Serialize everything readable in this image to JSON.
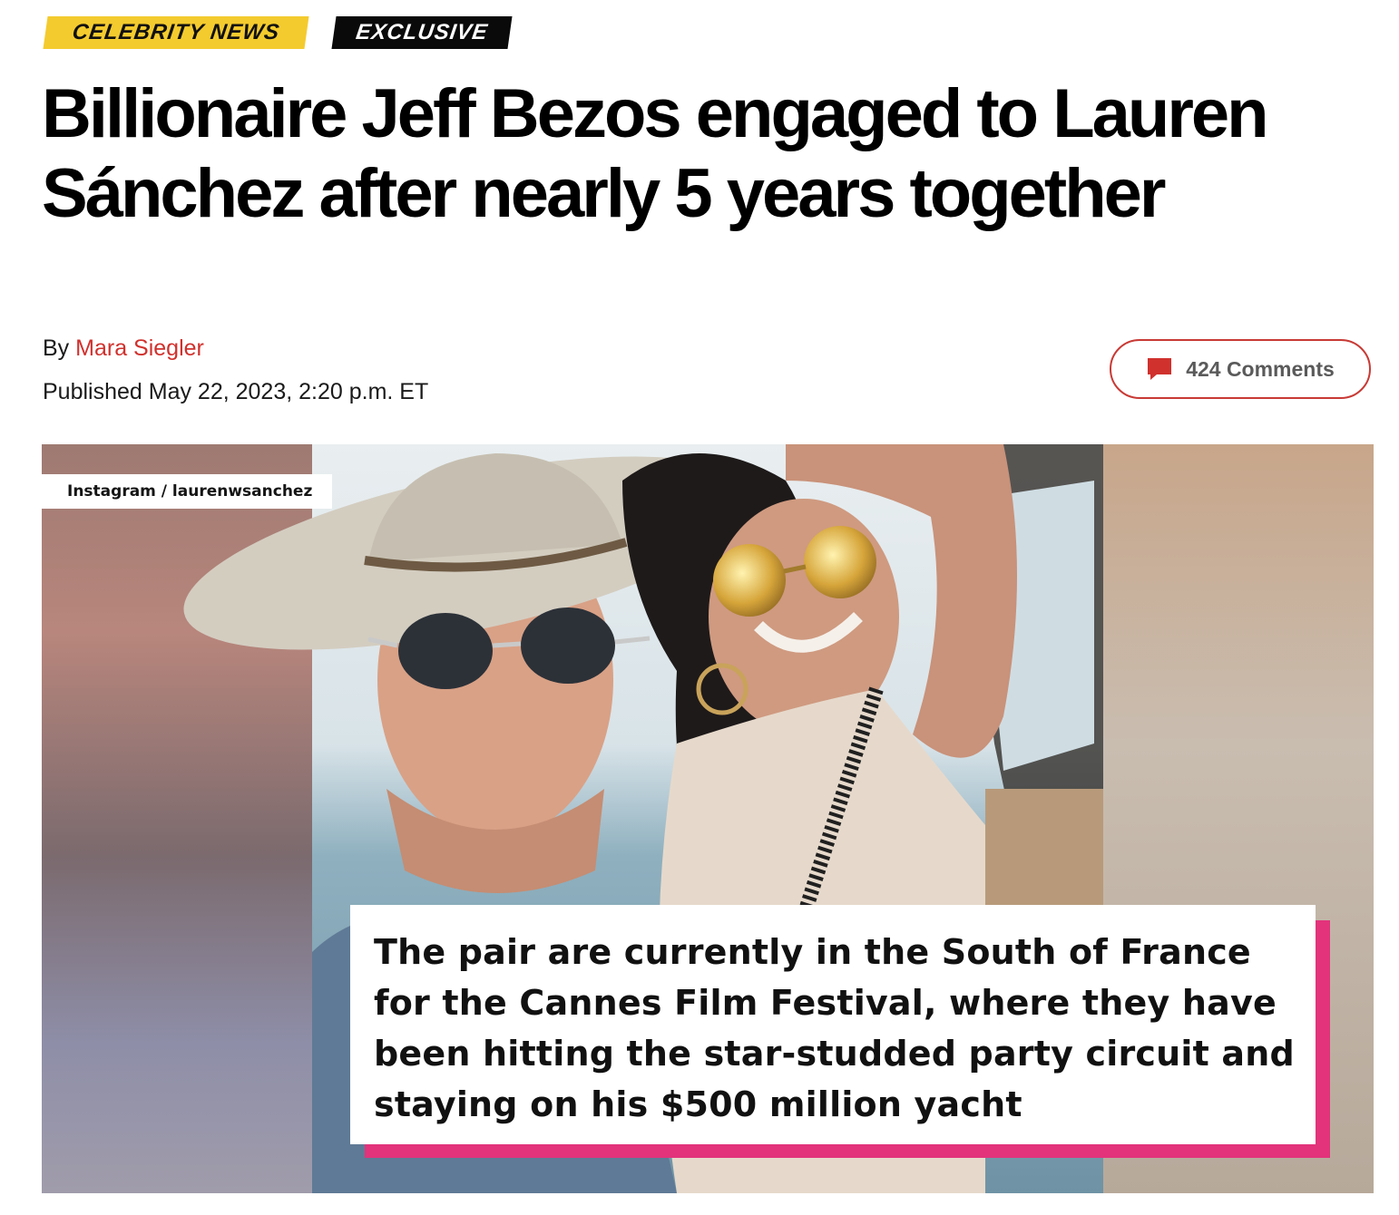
{
  "tags": {
    "category": "CELEBRITY NEWS",
    "exclusive": "EXCLUSIVE"
  },
  "article": {
    "headline": "Billionaire Jeff Bezos engaged to Lauren Sánchez after nearly 5 years together",
    "byline_prefix": "By",
    "author": "Mara Siegler",
    "published": "Published May 22, 2023, 2:20 p.m. ET"
  },
  "comments": {
    "label": "424 Comments",
    "icon": "comment-bubble-icon",
    "color": "#c83a35"
  },
  "photo": {
    "credit": "Instagram / laurenwsanchez",
    "caption": "The pair are currently in the South of France for the Cannes Film Festival, where they have been hitting the star-studded party circuit and staying on his $500 million yacht"
  },
  "colors": {
    "tag_yellow": "#f4cb2e",
    "tag_black": "#0a0a0a",
    "author_red": "#d0312d",
    "caption_accent": "#e2337b"
  }
}
